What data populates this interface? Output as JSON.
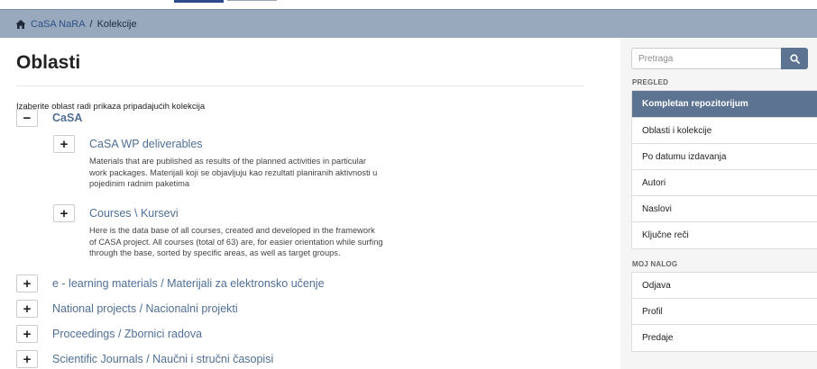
{
  "breadcrumb": {
    "home_label": "CaSA NaRA",
    "separator": "/",
    "current": "Kolekcije"
  },
  "main": {
    "title": "Oblasti",
    "intro": "Izaberite oblast radi prikaza pripadajućih kolekcija",
    "communities": [
      {
        "toggle": "−",
        "label": "CaSA",
        "expanded": true
      },
      {
        "toggle": "+",
        "label": "e - learning materials / Materijali za elektronsko učenje"
      },
      {
        "toggle": "+",
        "label": "National projects / Nacionalni projekti"
      },
      {
        "toggle": "+",
        "label": "Proceedings / Zbornici radova"
      },
      {
        "toggle": "+",
        "label": "Scientific Journals / Naučni i stručni časopisi"
      }
    ],
    "subcommunities": [
      {
        "toggle": "+",
        "label": "CaSA WP deliverables",
        "desc_lines": [
          "Materials that are published as results of the planned activities in particular",
          "work packages. Materijali koji se objavljuju kao rezultati planiranih aktivnosti u",
          "pojedinim radnim paketima"
        ]
      },
      {
        "toggle": "+",
        "label": "Courses \\ Kursevi",
        "desc_lines": [
          "Here is the data base of all courses, created and developed in the framework",
          "of CASA project. All courses (total of 63) are, for easier orientation while surfing",
          "through the base, sorted by specific areas, as well as target groups."
        ]
      }
    ]
  },
  "sidebar": {
    "search_placeholder": "Pretraga",
    "browse_heading": "PREGLED",
    "browse_items": [
      "Kompletan repozitorijum",
      "Oblasti i kolekcije",
      "Po datumu izdavanja",
      "Autori",
      "Naslovi",
      "Ključne reči"
    ],
    "account_heading": "MOJ NALOG",
    "account_items": [
      "Odjava",
      "Profil",
      "Predaje"
    ]
  },
  "colors": {
    "breadcrumb_bg": "#98a8bd",
    "accent": "#5c7491",
    "link": "#4f6f96"
  }
}
